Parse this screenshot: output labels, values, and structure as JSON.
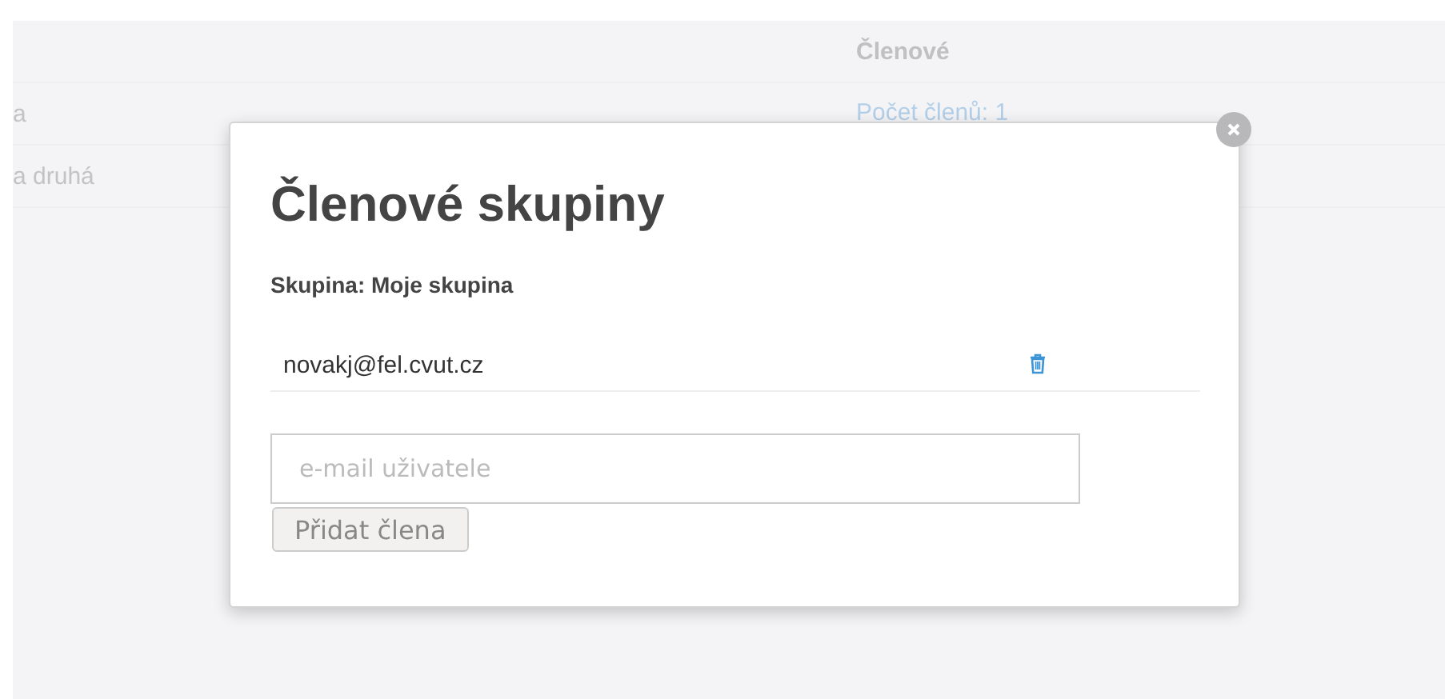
{
  "table": {
    "columns": [
      "",
      "Členové"
    ],
    "rows": [
      {
        "name": "a",
        "members": "Počet členů: 1"
      },
      {
        "name": "a druhá",
        "members": ""
      }
    ]
  },
  "modal": {
    "title": "Členové skupiny",
    "group_label": "Skupina: Moje skupina",
    "members": [
      {
        "email": "novakj@fel.cvut.cz"
      }
    ],
    "email_field": {
      "placeholder": "e-mail uživatele"
    },
    "add_button": {
      "label": "Přidat člena",
      "disabled": true
    }
  }
}
